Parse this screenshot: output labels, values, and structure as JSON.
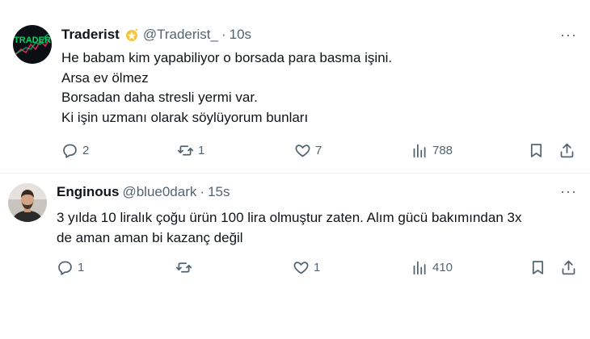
{
  "tweets": [
    {
      "name": "Traderist",
      "handle": "@Traderist_",
      "separator": "·",
      "time": "10s",
      "avatar_text": "TRADER",
      "lines": [
        "He babam kim yapabiliyor o borsada para basma işini.",
        "Arsa ev ölmez",
        "Borsadan daha stresli yermi var.",
        "Ki işin uzmanı olarak söylüyorum bunları"
      ],
      "replies": "2",
      "reposts": "1",
      "likes": "7",
      "views": "788",
      "more": "···"
    },
    {
      "name": "Enginous",
      "handle": "@blue0dark",
      "separator": "·",
      "time": "15s",
      "lines": [
        "3 yılda 10 liralık çoğu ürün 100 lira olmuştur zaten. Alım gücü bakımından 3x",
        "de aman aman bi kazanç değil"
      ],
      "replies": "1",
      "reposts": "",
      "likes": "1",
      "views": "410",
      "more": "···"
    }
  ],
  "colors": {
    "text": "#0f1419",
    "muted": "#536471",
    "accent": "#00d26a"
  }
}
